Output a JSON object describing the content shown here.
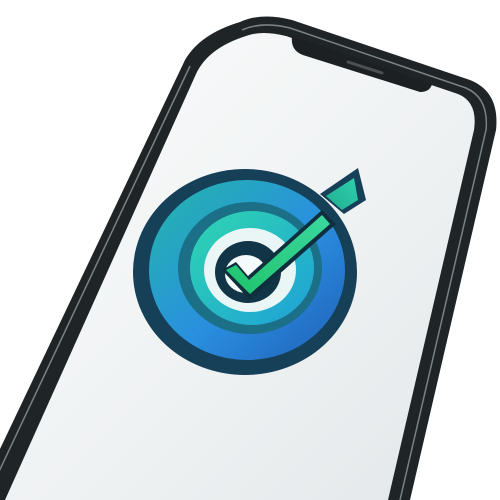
{
  "scene": {
    "subject": "smartphone",
    "screen_icon": "target-check-icon"
  },
  "colors": {
    "phone_frame": "#1f2426",
    "phone_frame_edge": "#6f7679",
    "screen": "#f2f4f5",
    "icon_outer_ring": "#1a5f7e",
    "icon_blue": "#2b8fe0",
    "icon_teal": "#1fb7b0",
    "icon_green": "#28c76f",
    "icon_dark": "#0f2f3f"
  }
}
